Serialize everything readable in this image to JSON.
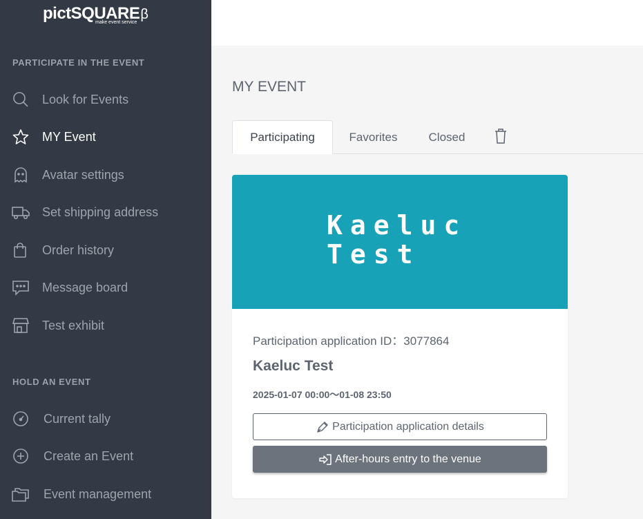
{
  "brand": {
    "name": "pictSQUARE",
    "beta": "β",
    "tagline": "make event service"
  },
  "sidebar": {
    "participate_title": "PARTICIPATE IN THE EVENT",
    "participate_items": [
      {
        "label": "Look for Events",
        "icon": "search-icon"
      },
      {
        "label": "MY Event",
        "icon": "star-icon",
        "active": true
      },
      {
        "label": "Avatar settings",
        "icon": "ghost-icon"
      },
      {
        "label": "Set shipping address",
        "icon": "truck-icon"
      },
      {
        "label": "Order history",
        "icon": "shopping-bag-icon"
      },
      {
        "label": "Message board",
        "icon": "message-icon"
      },
      {
        "label": "Test exhibit",
        "icon": "store-icon"
      }
    ],
    "hold_title": "HOLD AN EVENT",
    "hold_items": [
      {
        "label": "Current tally",
        "icon": "gauge-icon"
      },
      {
        "label": "Create an Event",
        "icon": "plus-circle-icon"
      },
      {
        "label": "Event management",
        "icon": "folders-icon"
      }
    ]
  },
  "main": {
    "title": "MY EVENT",
    "tabs": [
      {
        "label": "Participating",
        "active": true
      },
      {
        "label": "Favorites"
      },
      {
        "label": "Closed"
      }
    ],
    "trash_icon": "trash-icon",
    "card": {
      "banner_text": "Kaeluc Test",
      "banner_color": "#17a2b8",
      "application_id": "Participation application ID：3077864",
      "event_name": "Kaeluc Test",
      "event_dates": "2025-01-07 00:00〜01-08 23:50",
      "details_button": "Participation application details",
      "entry_button": "After-hours entry to the venue"
    }
  }
}
